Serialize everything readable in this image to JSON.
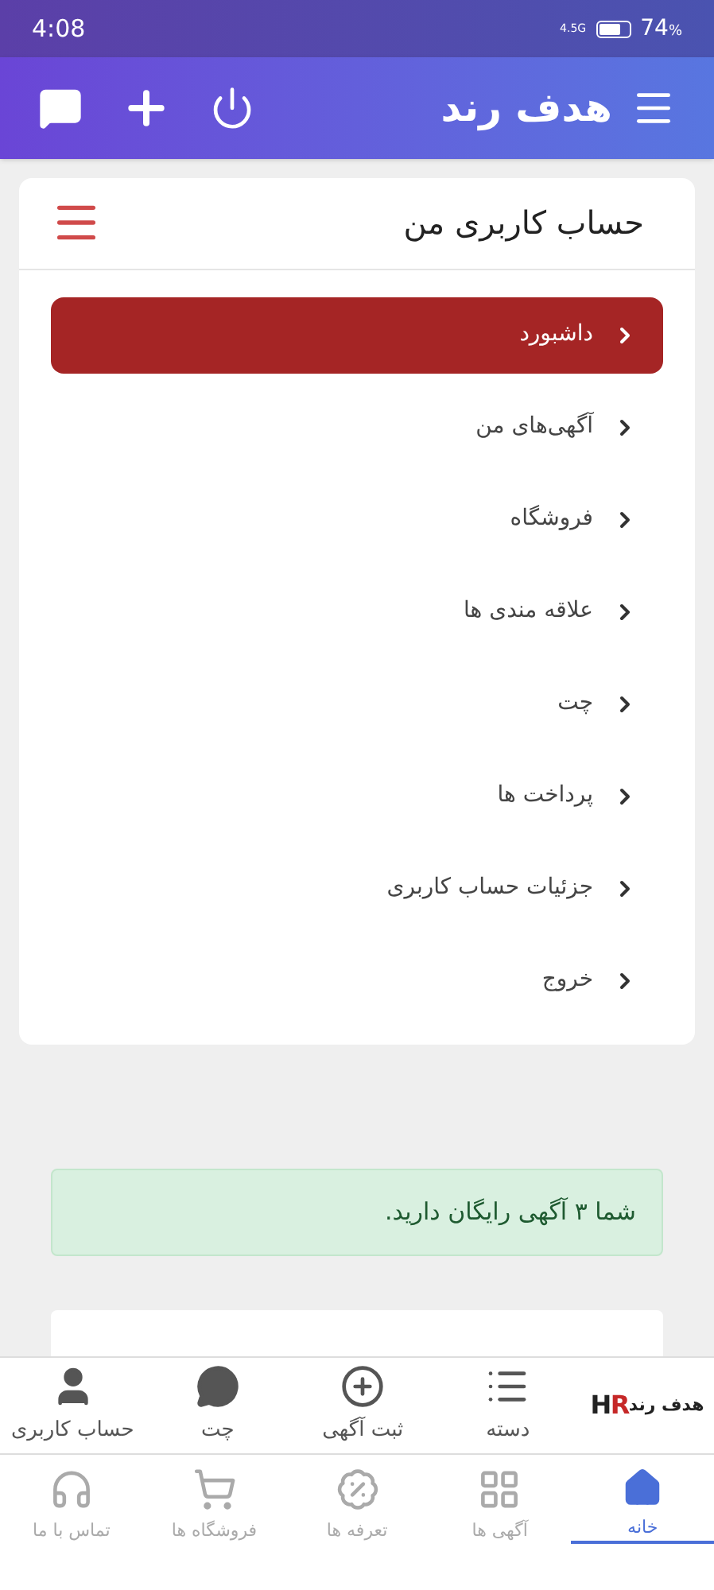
{
  "status_bar": {
    "time": "4:08",
    "network": "4.5G",
    "battery": "74",
    "battery_unit": "%"
  },
  "header": {
    "title": "هدف رند"
  },
  "card": {
    "title": "حساب کاربری من"
  },
  "menu": [
    {
      "label": "داشبورد",
      "selected": true
    },
    {
      "label": "آگهی‌های من",
      "selected": false
    },
    {
      "label": "فروشگاه",
      "selected": false
    },
    {
      "label": "علاقه مندی ها",
      "selected": false
    },
    {
      "label": "چت",
      "selected": false
    },
    {
      "label": "پرداخت ها",
      "selected": false
    },
    {
      "label": "جزئیات حساب کاربری",
      "selected": false
    },
    {
      "label": "خروج",
      "selected": false
    }
  ],
  "alert": "شما ۳ آگهی رایگان دارید.",
  "toolbar": {
    "logo_mark": "HR",
    "logo_text": "هدف رند",
    "items": [
      {
        "kind": "list",
        "label": "دسته"
      },
      {
        "kind": "plus",
        "label": "ثبت آگهی"
      },
      {
        "kind": "chat",
        "label": "چت"
      },
      {
        "kind": "user",
        "label": "حساب کاربری"
      }
    ]
  },
  "tabs": [
    {
      "kind": "home",
      "label": "خانه",
      "selected": true
    },
    {
      "kind": "grid",
      "label": "آگهی ها",
      "selected": false
    },
    {
      "kind": "percent",
      "label": "تعرفه ها",
      "selected": false
    },
    {
      "kind": "cart",
      "label": "فروشگاه ها",
      "selected": false
    },
    {
      "kind": "support",
      "label": "تماس با ما",
      "selected": false
    }
  ]
}
